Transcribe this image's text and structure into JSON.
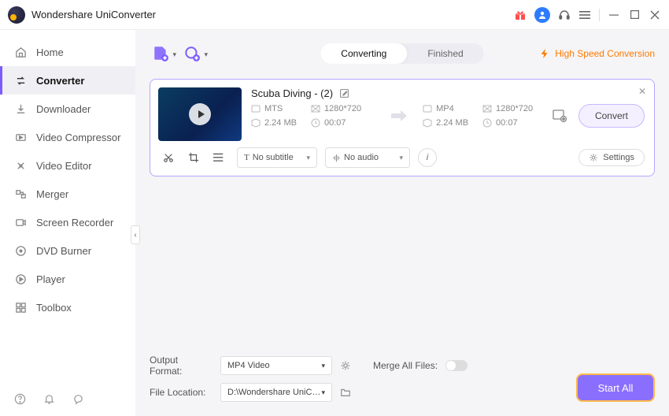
{
  "app_title": "Wondershare UniConverter",
  "titlebar": {
    "icons": [
      "gift-icon",
      "avatar-icon",
      "headset-icon",
      "menu-icon",
      "minimize-icon",
      "maximize-icon",
      "close-icon"
    ]
  },
  "sidebar": {
    "items": [
      {
        "label": "Home",
        "icon": "home-icon"
      },
      {
        "label": "Converter",
        "icon": "converter-icon",
        "active": true
      },
      {
        "label": "Downloader",
        "icon": "downloader-icon"
      },
      {
        "label": "Video Compressor",
        "icon": "compressor-icon"
      },
      {
        "label": "Video Editor",
        "icon": "editor-icon"
      },
      {
        "label": "Merger",
        "icon": "merger-icon"
      },
      {
        "label": "Screen Recorder",
        "icon": "recorder-icon"
      },
      {
        "label": "DVD Burner",
        "icon": "burner-icon"
      },
      {
        "label": "Player",
        "icon": "player-icon"
      },
      {
        "label": "Toolbox",
        "icon": "toolbox-icon"
      }
    ]
  },
  "tabs": {
    "converting": "Converting",
    "finished": "Finished"
  },
  "high_speed_label": "High Speed Conversion",
  "file": {
    "title": "Scuba Diving - (2)",
    "source": {
      "format": "MTS",
      "resolution": "1280*720",
      "size": "2.24 MB",
      "duration": "00:07"
    },
    "target": {
      "format": "MP4",
      "resolution": "1280*720",
      "size": "2.24 MB",
      "duration": "00:07"
    },
    "convert_label": "Convert",
    "subtitle_label": "No subtitle",
    "audio_label": "No audio",
    "settings_label": "Settings"
  },
  "footer": {
    "output_format_label": "Output Format:",
    "output_format_value": "MP4 Video",
    "file_location_label": "File Location:",
    "file_location_value": "D:\\Wondershare UniConverter",
    "merge_label": "Merge All Files:",
    "start_all_label": "Start All"
  }
}
